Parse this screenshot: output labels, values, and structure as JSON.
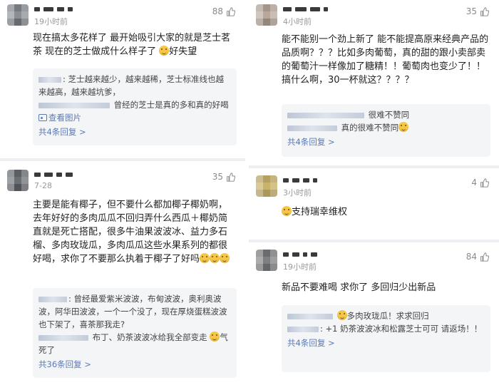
{
  "comments_left": [
    {
      "likes": "88",
      "time": "19小时前",
      "text": "现在搞太多花样了 最开始吸引大家的就是芝士茗茶 现在的芝士做成什么样子了",
      "text_tail": "好失望",
      "replies": [
        {
          "text": ": 芝士越来越少，越来越稀，芝士标准线也越来越高，越来越坑爹，"
        },
        {
          "text": "曾经的芝士是真的多和真的好喝",
          "link": "查看图片"
        }
      ],
      "more": "共4条回复 >"
    },
    {
      "likes": "35",
      "time": "7-28",
      "text": "主要是能有椰子，但不要什么都加椰子椰奶啊，去年好好的多肉瓜瓜不回归弄什么西瓜＋椰奶简直就是死亡搭配，很多牛油果波波冰、益力多石榴、多肉玫珑瓜，多肉瓜瓜这些水果系列的都很好喝，求你了不要那么执着于椰子了好吗",
      "replies": [
        {
          "text": ": 曾经最爱紫米波波，布甸波波，奥利奥波波，阿华田波波，一个一个没了，现在厚烧蛋糕波波也下架了，喜茶那我走?"
        },
        {
          "text": "布丁、奶茶波波冰给我全部变走",
          "tail": "气死了"
        }
      ],
      "more": "共36条回复 >"
    }
  ],
  "comments_right": [
    {
      "likes": "35",
      "time": "4小时前",
      "text": "能不能别一个劲上新了 能不能提高原来经典产品的品质啊？？？比如多肉葡萄，真的甜的跟小卖部卖的葡萄汁一样像加了糖精！！葡萄肉也变少了！！搞什么啊，30一杯就这？？？？",
      "replies": [
        {
          "text": "很难不赞同"
        },
        {
          "text": "真的很难不赞同"
        }
      ],
      "more": "共4条回复 >"
    },
    {
      "likes": "4",
      "time": "3小时前",
      "text": "支持瑞幸维权"
    },
    {
      "likes": "84",
      "time": "19小时前",
      "text": "新品不要难喝 求你了 多回归少出新品",
      "replies": [
        {
          "text": "多肉玫珑瓜！求求回归"
        },
        {
          "text": ": +1 奶茶波波冰和松露芝士可可 请返场！！"
        }
      ],
      "more": "共4条回复 >"
    }
  ]
}
